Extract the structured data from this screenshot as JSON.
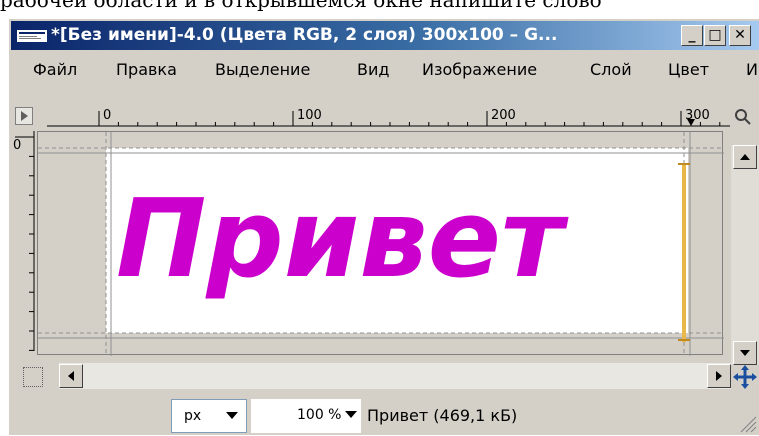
{
  "document": {
    "above_text": "рабочей области и в открывшемся окне напишите слово"
  },
  "window": {
    "title": "*[Без имени]-4.0 (Цвета RGB, 2 слоя) 300x100 – G...",
    "minimize_glyph": "_",
    "maximize_glyph": "□",
    "close_glyph": "✕"
  },
  "menu": {
    "items": [
      {
        "label": "Файл"
      },
      {
        "label": "Правка"
      },
      {
        "label": "Выделение"
      },
      {
        "label": "Вид"
      },
      {
        "label": "Изображение"
      },
      {
        "label": "Слой"
      },
      {
        "label": "Цвет"
      },
      {
        "label": "И"
      }
    ]
  },
  "ruler": {
    "h_labels": [
      "0",
      "100",
      "200",
      "300"
    ],
    "v_labels": [
      "0"
    ]
  },
  "canvas": {
    "text": "Привет",
    "text_color": "#cc00cc"
  },
  "status": {
    "unit": "px",
    "zoom": "100 %",
    "info": "Привет (469,1 кБ)"
  },
  "icons": {
    "nav": "navigate-icon",
    "quickmask": "quick-mask-icon",
    "zoom": "zoom-icon",
    "move": "move-cross-icon"
  }
}
